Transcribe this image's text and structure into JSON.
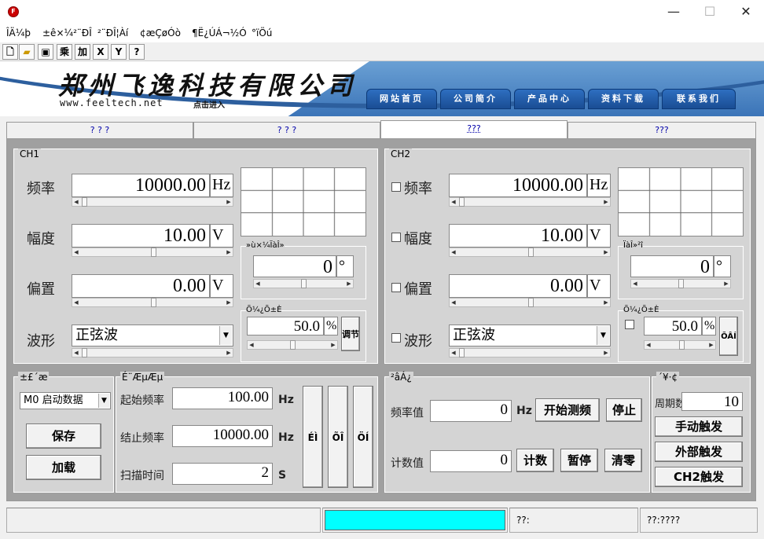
{
  "window": {
    "minimize": "—",
    "maximize": "☐",
    "close": "✕"
  },
  "menu": [
    "ÎÄ¼þ",
    "±ê×¼²¨ÐÎ",
    "²¨ÐÎ¦Àí",
    "¢æÇøÓò",
    "¶Ë¿ÚÁ¬½Ó",
    "°ïÖú"
  ],
  "toolbar": {
    "mul": "乘",
    "add": "加",
    "x": "X",
    "y": "Y",
    "help": "?"
  },
  "banner": {
    "company": "郑州飞逸科技有限公司",
    "website": "www.feeltech.net",
    "website_sub": "点击进入",
    "nav": [
      "网站首页",
      "公司简介",
      "产品中心",
      "资料下载",
      "联系我们"
    ]
  },
  "tabs": [
    "? ? ?",
    "? ? ?",
    "???",
    "???"
  ],
  "ch1": {
    "title": "CH1",
    "freq_label": "频率",
    "freq_value": "10000.00",
    "freq_unit": "Hz",
    "amp_label": "幅度",
    "amp_value": "10.00",
    "amp_unit": "V",
    "offset_label": "偏置",
    "offset_value": "0.00",
    "offset_unit": "V",
    "wave_label": "波形",
    "wave_value": "正弦波",
    "phase_group": "»ù×¼ÏàÎ»",
    "phase_value": "0",
    "phase_unit": "°",
    "duty_group": "Õ¼¿Õ±È",
    "duty_value": "50.0",
    "duty_unit": "%",
    "duty_btn": "调节"
  },
  "ch2": {
    "title": "CH2",
    "freq_label": "频率",
    "freq_value": "10000.00",
    "freq_unit": "Hz",
    "amp_label": "幅度",
    "amp_value": "10.00",
    "amp_unit": "V",
    "offset_label": "偏置",
    "offset_value": "0.00",
    "offset_unit": "V",
    "wave_label": "波形",
    "wave_value": "正弦波",
    "phase_group": "ÏàÎ»²î",
    "phase_value": "0",
    "phase_unit": "°",
    "duty_group": "Õ¼¿Õ±È",
    "duty_value": "50.0",
    "duty_unit": "%",
    "duty_btn": "ÕÂÍ"
  },
  "storage": {
    "title": "±£´æ",
    "select": "M0 启动数据",
    "save": "保存",
    "load": "加载"
  },
  "sweep": {
    "title": "É¨ÆµÆµ",
    "start_label": "起始频率",
    "start_value": "100.00",
    "start_unit": "Hz",
    "stop_label": "结止频率",
    "stop_value": "10000.00",
    "stop_unit": "Hz",
    "time_label": "扫描时间",
    "time_value": "2",
    "time_unit": "S",
    "btns": [
      "ÉÌ",
      "ÕÎ",
      "ÖÍ"
    ]
  },
  "measure": {
    "title": "²âÁ¿",
    "freq_label": "频率值",
    "freq_value": "0",
    "freq_unit": "Hz",
    "start_btn": "开始测频",
    "stop_btn": "停止",
    "count_label": "计数值",
    "count_value": "0",
    "count_btn": "计数",
    "pause_btn": "暂停",
    "clear_btn": "清零"
  },
  "trigger": {
    "title": "´¥·¢",
    "period_label": "周期数",
    "period_value": "10",
    "manual": "手动触发",
    "external": "外部触发",
    "ch2": "CH2触发"
  },
  "status": {
    "s3": "??:",
    "s4": "??:????"
  },
  "colors": {
    "status_cyan": "#00ffff",
    "banner_blue": "#2e6fc0"
  }
}
